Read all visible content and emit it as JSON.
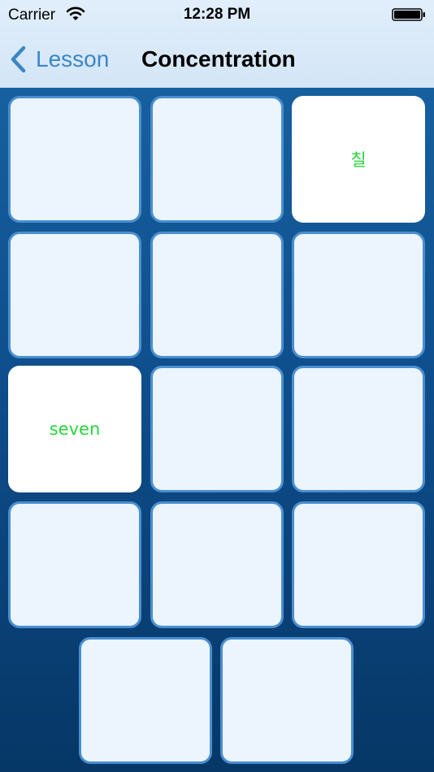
{
  "status_bar": {
    "carrier": "Carrier",
    "time": "12:28 PM"
  },
  "nav": {
    "back_label": "Lesson",
    "title": "Concentration"
  },
  "colors": {
    "accent": "#3a86c7",
    "card_back": "#ecf4fd",
    "card_border": "#4a8fd0",
    "card_face": "#ffffff",
    "match_text": "#28d63c",
    "board_background": "#0f4f8e"
  },
  "cards": [
    {
      "face_up": false,
      "text": ""
    },
    {
      "face_up": false,
      "text": ""
    },
    {
      "face_up": true,
      "text": "칠"
    },
    {
      "face_up": false,
      "text": ""
    },
    {
      "face_up": false,
      "text": ""
    },
    {
      "face_up": false,
      "text": ""
    },
    {
      "face_up": true,
      "text": "seven"
    },
    {
      "face_up": false,
      "text": ""
    },
    {
      "face_up": false,
      "text": ""
    },
    {
      "face_up": false,
      "text": ""
    },
    {
      "face_up": false,
      "text": ""
    },
    {
      "face_up": false,
      "text": ""
    },
    {
      "face_up": false,
      "text": ""
    },
    {
      "face_up": false,
      "text": ""
    }
  ]
}
